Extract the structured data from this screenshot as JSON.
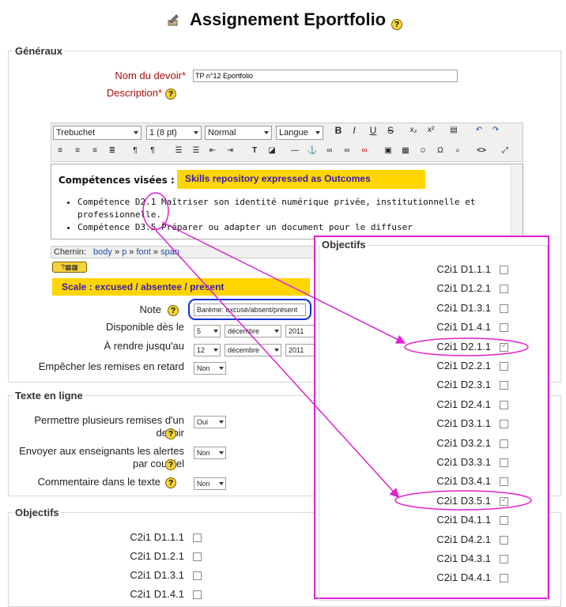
{
  "page": {
    "title": "Assignement Eportfolio",
    "help": "?"
  },
  "generaux": {
    "legend": "Généraux",
    "name_label": "Nom du devoir",
    "name_value": "TP n°12 Eportfolio",
    "desc_label": "Description",
    "required": "*",
    "editor": {
      "font": "Trebuchet",
      "size": "1 (8 pt)",
      "style": "Normal",
      "lang": "Langue",
      "heading": "Compétences visées :",
      "items": [
        "Compétence D2.1 Maîtriser son identité numérique privée, institutionnelle et professionnelle.",
        "Compétence D3.5 Préparer ou adapter un document pour le diffuser"
      ],
      "path_label": "Chemin:",
      "path": [
        "body",
        "p",
        "font",
        "span"
      ]
    },
    "note_label": "Note",
    "note_value": "Barème: excusé/absent/présent",
    "from_label": "Disponible dès le",
    "from_day": "5",
    "from_month": "décembre",
    "from_year": "2011",
    "due_label": "À rendre jusqu'au",
    "due_day": "12",
    "due_month": "décembre",
    "due_year": "2011",
    "late_label": "Empêcher les remises en retard",
    "late_value": "Non"
  },
  "annotations": {
    "skills": "Skills repository expressed as Outcomes",
    "scale": "Scale : excused / absentee / present",
    "colors": {
      "yellow": "#ffd500",
      "text": "#3a1ab0",
      "magenta": "#e020d0",
      "blue": "#1030d0"
    }
  },
  "texte": {
    "legend": "Texte en ligne",
    "multi_label": "Permettre plusieurs remises d'un devoir",
    "multi_value": "Oui",
    "alert_label": "Envoyer aux enseignants les alertes par courriel",
    "alert_value": "Non",
    "comment_label": "Commentaire dans le texte",
    "comment_value": "Non"
  },
  "objectifs": {
    "legend": "Objectifs",
    "items": [
      "C2i1 D1.1.1",
      "C2i1 D1.2.1",
      "C2i1 D1.3.1",
      "C2i1 D1.4.1"
    ]
  },
  "popup": {
    "legend": "Objectifs",
    "items": [
      {
        "label": "C2i1 D1.1.1",
        "checked": false
      },
      {
        "label": "C2i1 D1.2.1",
        "checked": false
      },
      {
        "label": "C2i1 D1.3.1",
        "checked": false
      },
      {
        "label": "C2i1 D1.4.1",
        "checked": false
      },
      {
        "label": "C2i1 D2.1.1",
        "checked": true
      },
      {
        "label": "C2i1 D2.2.1",
        "checked": false
      },
      {
        "label": "C2i1 D2.3.1",
        "checked": false
      },
      {
        "label": "C2i1 D2.4.1",
        "checked": false
      },
      {
        "label": "C2i1 D3.1.1",
        "checked": false
      },
      {
        "label": "C2i1 D3.2.1",
        "checked": false
      },
      {
        "label": "C2i1 D3.3.1",
        "checked": false
      },
      {
        "label": "C2i1 D3.4.1",
        "checked": false
      },
      {
        "label": "C2i1 D3.5.1",
        "checked": true
      },
      {
        "label": "C2i1 D4.1.1",
        "checked": false
      },
      {
        "label": "C2i1 D4.2.1",
        "checked": false
      },
      {
        "label": "C2i1 D4.3.1",
        "checked": false
      },
      {
        "label": "C2i1 D4.4.1",
        "checked": false
      }
    ]
  }
}
